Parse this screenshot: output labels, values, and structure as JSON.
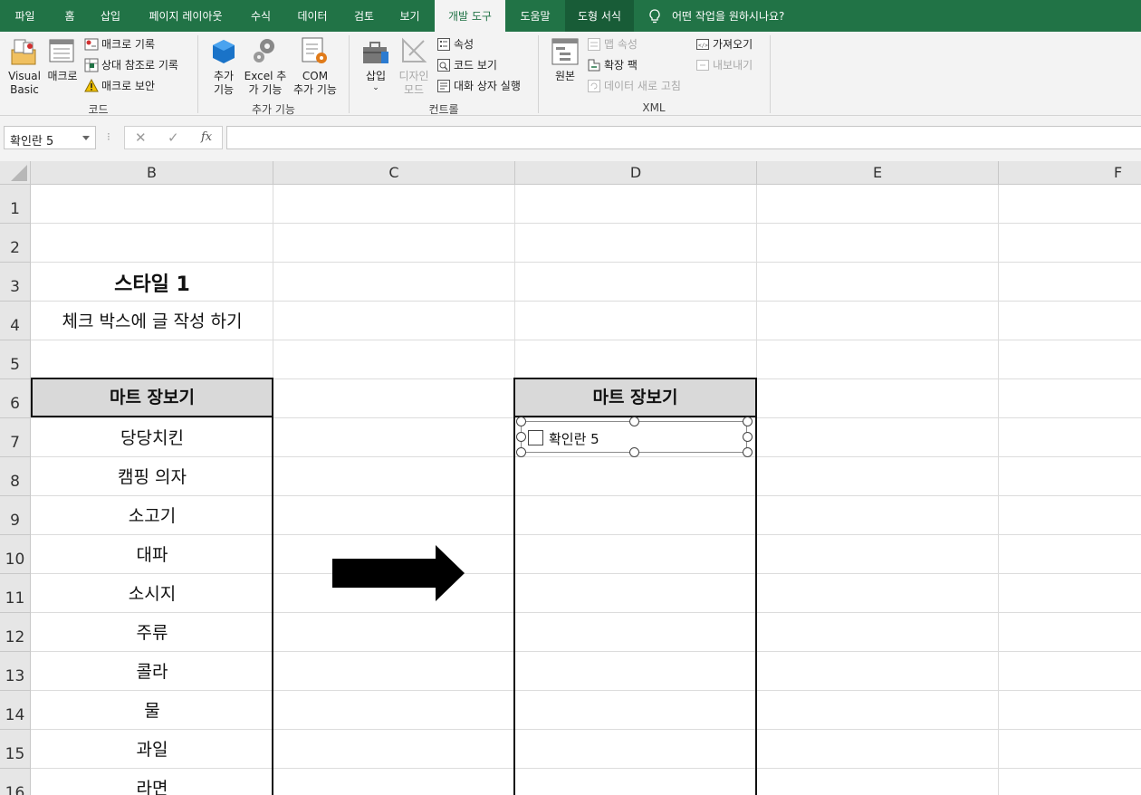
{
  "tabs": [
    {
      "label": "파일"
    },
    {
      "label": "홈"
    },
    {
      "label": "삽입"
    },
    {
      "label": "페이지 레이아웃"
    },
    {
      "label": "수식"
    },
    {
      "label": "데이터"
    },
    {
      "label": "검토"
    },
    {
      "label": "보기"
    },
    {
      "label": "개발 도구",
      "active": true
    },
    {
      "label": "도움말"
    },
    {
      "label": "도형 서식"
    }
  ],
  "tell_me": "어떤 작업을 원하시나요?",
  "ribbon": {
    "code": {
      "label": "코드",
      "visual_basic": "Visual\nBasic",
      "visual_basic_l1": "Visual",
      "visual_basic_l2": "Basic",
      "macro": "매크로",
      "record_macro": "매크로 기록",
      "relative_ref": "상대 참조로 기록",
      "macro_security": "매크로 보안"
    },
    "addins": {
      "label": "추가 기능",
      "addins_l1": "추가",
      "addins_l2": "기능",
      "excel_l1": "Excel 추",
      "excel_l2": "가 기능",
      "com_l1": "COM",
      "com_l2": "추가 기능"
    },
    "controls": {
      "label": "컨트롤",
      "insert": "삽입",
      "design_l1": "디자인",
      "design_l2": "모드",
      "properties": "속성",
      "view_code": "코드 보기",
      "run_dialog": "대화 상자 실행"
    },
    "xml": {
      "label": "XML",
      "source": "원본",
      "map_properties": "맵 속성",
      "expansion_packs": "확장 팩",
      "refresh_data": "데이터 새로 고침",
      "import": "가져오기",
      "export": "내보내기"
    }
  },
  "formula_bar": {
    "name_box": "확인란 5",
    "fx": "fx",
    "formula": ""
  },
  "columns": [
    "B",
    "C",
    "D",
    "E",
    "F"
  ],
  "rows": [
    "1",
    "2",
    "3",
    "4",
    "5",
    "6",
    "7",
    "8",
    "9",
    "10",
    "11",
    "12",
    "13",
    "14",
    "15",
    "16"
  ],
  "sheet": {
    "title": "스타일 1",
    "subtitle": "체크 박스에 글 작성 하기",
    "left_header": "마트 장보기",
    "right_header": "마트 장보기",
    "items": [
      "당당치킨",
      "캠핑 의자",
      "소고기",
      "대파",
      "소시지",
      "주류",
      "콜라",
      "물",
      "과일",
      "라면"
    ]
  },
  "checkbox": {
    "label": "확인란 5",
    "checked": false
  },
  "colors": {
    "accent": "#217346",
    "header_fill": "#d9d9d9"
  }
}
